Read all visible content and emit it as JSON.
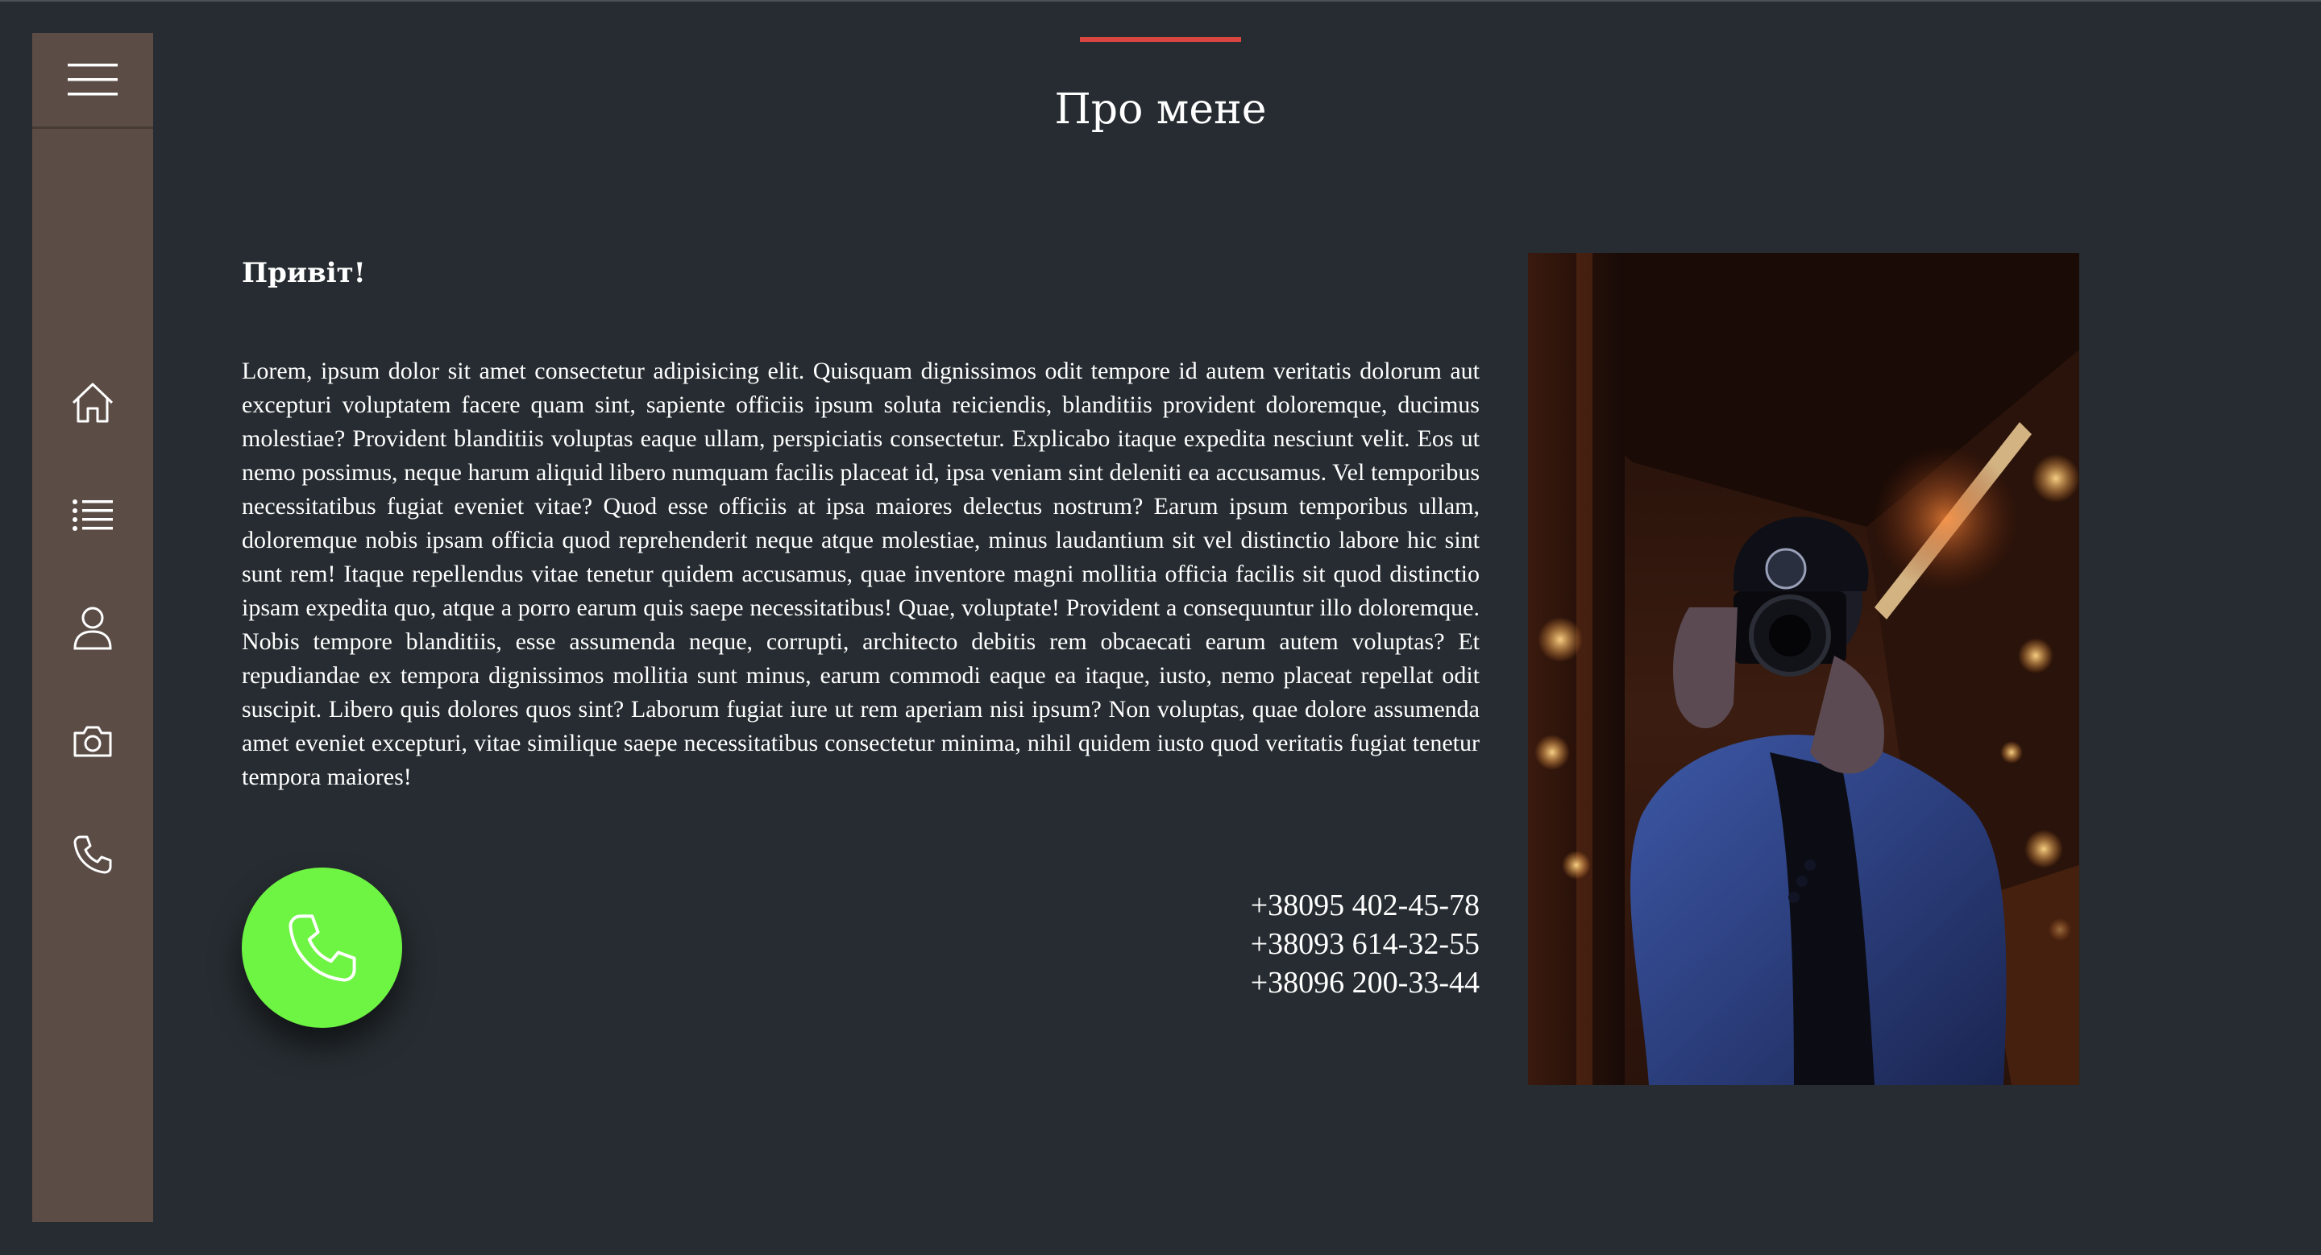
{
  "page": {
    "title": "Про мене",
    "accent_color": "#d9453f",
    "background_color": "#262c31"
  },
  "sidebar": {
    "color": "#5b4d46",
    "menu_icon": "hamburger-menu-icon",
    "items": [
      {
        "icon": "home-icon"
      },
      {
        "icon": "list-icon"
      },
      {
        "icon": "user-icon"
      },
      {
        "icon": "camera-icon"
      },
      {
        "icon": "phone-icon"
      }
    ]
  },
  "about": {
    "greeting": "Привіт!",
    "bio": "Lorem, ipsum dolor sit amet consectetur adipisicing elit. Quisquam dignissimos odit tempore id autem veritatis dolorum aut excepturi voluptatem facere quam sint, sapiente officiis ipsum soluta reiciendis, blanditiis provident doloremque, ducimus molestiae? Provident blanditiis voluptas eaque ullam, perspiciatis consectetur. Explicabo itaque expedita nesciunt velit. Eos ut nemo possimus, neque harum aliquid libero numquam facilis placeat id, ipsa veniam sint deleniti ea accusamus. Vel temporibus necessitatibus fugiat eveniet vitae? Quod esse officiis at ipsa maiores delectus nostrum? Earum ipsum temporibus ullam, doloremque nobis ipsam officia quod reprehenderit neque atque molestiae, minus laudantium sit vel distinctio labore hic sint sunt rem! Itaque repellendus vitae tenetur quidem accusamus, quae inventore magni mollitia officia facilis sit quod distinctio ipsam expedita quo, atque a porro earum quis saepe necessitatibus! Quae, voluptate! Provident a consequuntur illo doloremque. Nobis tempore blanditiis, esse assumenda neque, corrupti, architecto debitis rem obcaecati earum autem voluptas? Et repudiandae ex tempora dignissimos mollitia sunt minus, earum commodi eaque ea itaque, iusto, nemo placeat repellat odit suscipit. Libero quis dolores quos sint? Laborum fugiat iure ut rem aperiam nisi ipsum? Non voluptas, quae dolore assumenda amet eveniet excepturi, vitae similique saepe necessitatibus consectetur minima, nihil quidem iusto quod veritatis fugiat tenetur tempora maiores!",
    "phones": [
      "+38095 402-45-78",
      "+38093 614-32-55",
      "+38096 200-33-44"
    ]
  },
  "call_button": {
    "icon": "phone-icon",
    "color": "#6ef443"
  },
  "photo": {
    "subject": "photographer-with-camera-at-night"
  }
}
